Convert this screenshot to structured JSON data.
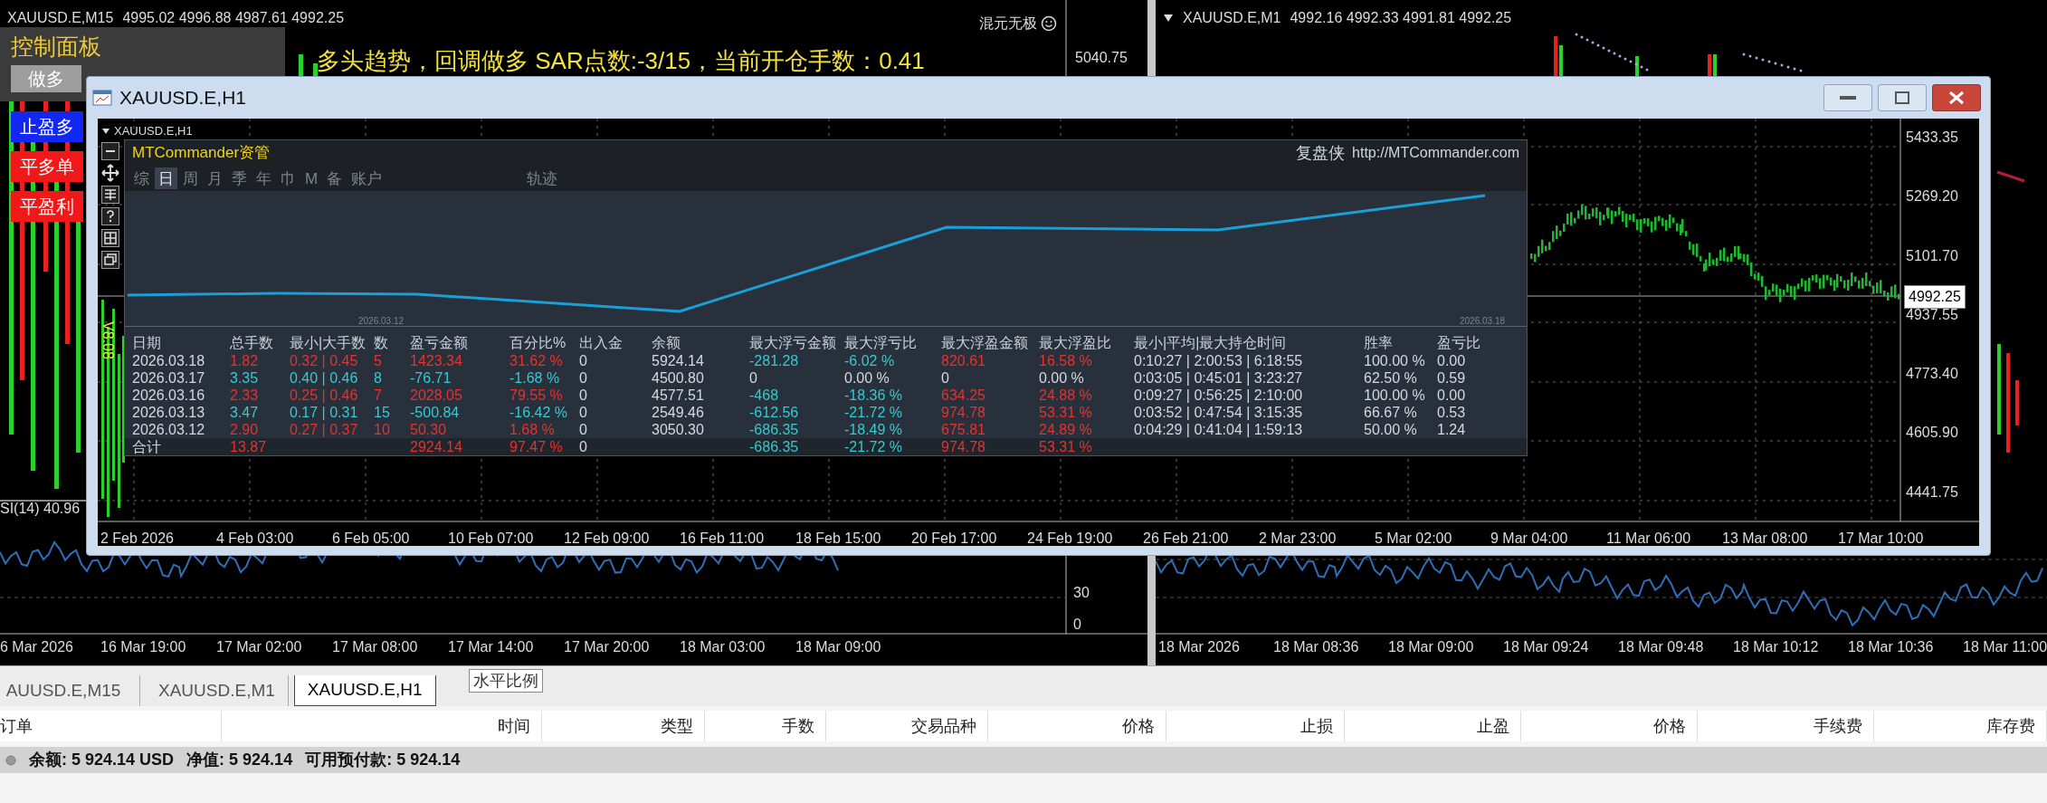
{
  "left_chart": {
    "symbol": "XAUUSD.E,M15",
    "ohlc": "4995.02 4996.88 4987.61 4992.25",
    "indicator_name": "混元无极",
    "price_label": "5040.75",
    "control_panel": {
      "title": "控制面板",
      "buttons": [
        {
          "label": "做多",
          "kind": "gray"
        }
      ]
    },
    "side_buttons": [
      {
        "label": "止盈多",
        "kind": "blue"
      },
      {
        "label": "平多单",
        "kind": "red"
      },
      {
        "label": "平盈利",
        "kind": "red"
      }
    ],
    "signal_text": "多头趋势，回调做多 SAR点数:-3/15，当前开仓手数：0.41",
    "rsi_label": "SI(14) 40.96",
    "rsi_levels": [
      "30",
      "0"
    ],
    "time_axis": [
      "6 Mar 2026",
      "16 Mar 19:00",
      "17 Mar 02:00",
      "17 Mar 08:00",
      "17 Mar 14:00",
      "17 Mar 20:00",
      "18 Mar 03:00",
      "18 Mar 09:00"
    ]
  },
  "right_chart": {
    "symbol": "XAUUSD.E,M1",
    "ohlc": "4992.16 4992.33 4991.81 4992.25",
    "time_axis": [
      "18 Mar 2026",
      "18 Mar 08:36",
      "18 Mar 09:00",
      "18 Mar 09:24",
      "18 Mar 09:48",
      "18 Mar 10:12",
      "18 Mar 10:36",
      "18 Mar 11:00"
    ]
  },
  "chart_window": {
    "title": "XAUUSD.E,H1",
    "chart_symbol": "XAUUSD.E,H1",
    "version": "V8.08",
    "price_axis": [
      {
        "text": "5433.35",
        "current": false
      },
      {
        "text": "5269.20",
        "current": false
      },
      {
        "text": "5101.70",
        "current": false
      },
      {
        "text": "4992.25",
        "current": true
      },
      {
        "text": "4937.55",
        "current": false
      },
      {
        "text": "4773.40",
        "current": false
      },
      {
        "text": "4605.90",
        "current": false
      },
      {
        "text": "4441.75",
        "current": false
      }
    ],
    "time_axis": [
      "2 Feb 2026",
      "4 Feb 03:00",
      "6 Feb 05:00",
      "10 Feb 07:00",
      "12 Feb 09:00",
      "16 Feb 11:00",
      "18 Feb 15:00",
      "20 Feb 17:00",
      "24 Feb 19:00",
      "26 Feb 21:00",
      "2 Mar 23:00",
      "5 Mar 02:00",
      "9 Mar 04:00",
      "11 Mar 06:00",
      "13 Mar 08:00",
      "17 Mar 10:00"
    ],
    "panel": {
      "title": "MTCommander资管",
      "brand": "复盘侠",
      "url": "http://MTCommander.com",
      "tabs": [
        {
          "label": "综",
          "selected": false
        },
        {
          "label": "日",
          "selected": true
        },
        {
          "label": "周",
          "selected": false
        },
        {
          "label": "月",
          "selected": false
        },
        {
          "label": "季",
          "selected": false
        },
        {
          "label": "年",
          "selected": false
        },
        {
          "label": "巾",
          "selected": false
        },
        {
          "label": "M",
          "selected": false
        },
        {
          "label": "备",
          "selected": false
        },
        {
          "label": "账户",
          "selected": false
        },
        {
          "label": "轨迹",
          "selected": false
        }
      ],
      "curve_dates": [
        "2026.03.12",
        "2026.03.18"
      ],
      "columns": [
        "日期",
        "总手数",
        "最小|大手数",
        "数",
        "盈亏金额",
        "百分比%",
        "出入金",
        "余额",
        "最大浮亏金额",
        "最大浮亏比",
        "最大浮盈金额",
        "最大浮盈比",
        "最小|平均|最大持仓时间",
        "胜率",
        "盈亏比"
      ],
      "rows": [
        {
          "kind": "day",
          "cells": [
            {
              "text": "2026.03.18"
            },
            {
              "text": "1.82",
              "color": "#e8312e"
            },
            {
              "text": "0.32 | 0.45",
              "color": "#e8312e"
            },
            {
              "text": "5",
              "color": "#e8312e"
            },
            {
              "text": "1423.34",
              "color": "#e8312e"
            },
            {
              "text": "31.62 %",
              "color": "#e8312e"
            },
            {
              "text": "0"
            },
            {
              "text": "5924.14"
            },
            {
              "text": "-281.28",
              "color": "#35c9d2"
            },
            {
              "text": "-6.02 %",
              "color": "#35c9d2"
            },
            {
              "text": "820.61",
              "color": "#e8312e"
            },
            {
              "text": "16.58 %",
              "color": "#e8312e"
            },
            {
              "text": "0:10:27 | 2:00:53 | 6:18:55"
            },
            {
              "text": "100.00 %"
            },
            {
              "text": "0.00"
            }
          ]
        },
        {
          "kind": "day",
          "cells": [
            {
              "text": "2026.03.17"
            },
            {
              "text": "3.35",
              "color": "#35c9d2"
            },
            {
              "text": "0.40 | 0.46",
              "color": "#35c9d2"
            },
            {
              "text": "8",
              "color": "#35c9d2"
            },
            {
              "text": "-76.71",
              "color": "#35c9d2"
            },
            {
              "text": "-1.68 %",
              "color": "#35c9d2"
            },
            {
              "text": "0"
            },
            {
              "text": "4500.80"
            },
            {
              "text": "0"
            },
            {
              "text": "0.00 %"
            },
            {
              "text": "0"
            },
            {
              "text": "0.00 %"
            },
            {
              "text": "0:03:05 | 0:45:01 | 3:23:27"
            },
            {
              "text": "62.50 %"
            },
            {
              "text": "0.59"
            }
          ]
        },
        {
          "kind": "day",
          "cells": [
            {
              "text": "2026.03.16"
            },
            {
              "text": "2.33",
              "color": "#e8312e"
            },
            {
              "text": "0.25 | 0.46",
              "color": "#e8312e"
            },
            {
              "text": "7",
              "color": "#e8312e"
            },
            {
              "text": "2028.05",
              "color": "#e8312e"
            },
            {
              "text": "79.55 %",
              "color": "#e8312e"
            },
            {
              "text": "0"
            },
            {
              "text": "4577.51"
            },
            {
              "text": "-468",
              "color": "#35c9d2"
            },
            {
              "text": "-18.36 %",
              "color": "#35c9d2"
            },
            {
              "text": "634.25",
              "color": "#e8312e"
            },
            {
              "text": "24.88 %",
              "color": "#e8312e"
            },
            {
              "text": "0:09:27 | 0:56:25 | 2:10:00"
            },
            {
              "text": "100.00 %"
            },
            {
              "text": "0.00"
            }
          ]
        },
        {
          "kind": "day",
          "cells": [
            {
              "text": "2026.03.13"
            },
            {
              "text": "3.47",
              "color": "#35c9d2"
            },
            {
              "text": "0.17 | 0.31",
              "color": "#35c9d2"
            },
            {
              "text": "15",
              "color": "#35c9d2"
            },
            {
              "text": "-500.84",
              "color": "#35c9d2"
            },
            {
              "text": "-16.42 %",
              "color": "#35c9d2"
            },
            {
              "text": "0"
            },
            {
              "text": "2549.46"
            },
            {
              "text": "-612.56",
              "color": "#35c9d2"
            },
            {
              "text": "-21.72 %",
              "color": "#35c9d2"
            },
            {
              "text": "974.78",
              "color": "#e8312e"
            },
            {
              "text": "53.31 %",
              "color": "#e8312e"
            },
            {
              "text": "0:03:52 | 0:47:54 | 3:15:35"
            },
            {
              "text": "66.67 %"
            },
            {
              "text": "0.53"
            }
          ]
        },
        {
          "kind": "day",
          "cells": [
            {
              "text": "2026.03.12"
            },
            {
              "text": "2.90",
              "color": "#e8312e"
            },
            {
              "text": "0.27 | 0.37",
              "color": "#e8312e"
            },
            {
              "text": "10",
              "color": "#e8312e"
            },
            {
              "text": "50.30",
              "color": "#e8312e"
            },
            {
              "text": "1.68 %",
              "color": "#e8312e"
            },
            {
              "text": "0"
            },
            {
              "text": "3050.30"
            },
            {
              "text": "-686.35",
              "color": "#35c9d2"
            },
            {
              "text": "-18.49 %",
              "color": "#35c9d2"
            },
            {
              "text": "675.81",
              "color": "#e8312e"
            },
            {
              "text": "24.89 %",
              "color": "#e8312e"
            },
            {
              "text": "0:04:29 | 0:41:04 | 1:59:13"
            },
            {
              "text": "50.00 %"
            },
            {
              "text": "1.24"
            }
          ]
        },
        {
          "kind": "total",
          "cells": [
            {
              "text": "合计"
            },
            {
              "text": "13.87",
              "color": "#e8312e"
            },
            null,
            null,
            {
              "text": "2924.14",
              "color": "#e8312e"
            },
            {
              "text": "97.47 %",
              "color": "#e8312e"
            },
            {
              "text": "0"
            },
            null,
            {
              "text": "-686.35",
              "color": "#35c9d2"
            },
            {
              "text": "-21.72 %",
              "color": "#35c9d2"
            },
            {
              "text": "974.78",
              "color": "#e8312e"
            },
            {
              "text": "53.31 %",
              "color": "#e8312e"
            },
            null,
            null,
            null
          ]
        }
      ]
    }
  },
  "terminal_tabs": [
    {
      "label": "AUUSD.E,M15",
      "selected": false
    },
    {
      "label": "XAUUSD.E,M1",
      "selected": false
    },
    {
      "label": "XAUUSD.E,H1",
      "selected": true
    }
  ],
  "tooltip": "水平比例",
  "orders_columns": [
    "订单",
    "时间",
    "类型",
    "手数",
    "交易品种",
    "价格",
    "止损",
    "止盈",
    "价格",
    "手续费",
    "库存费"
  ],
  "account_summary": [
    "余额: 5 924.14 USD",
    "净值: 5 924.14",
    "可用预付款: 5 924.14"
  ]
}
